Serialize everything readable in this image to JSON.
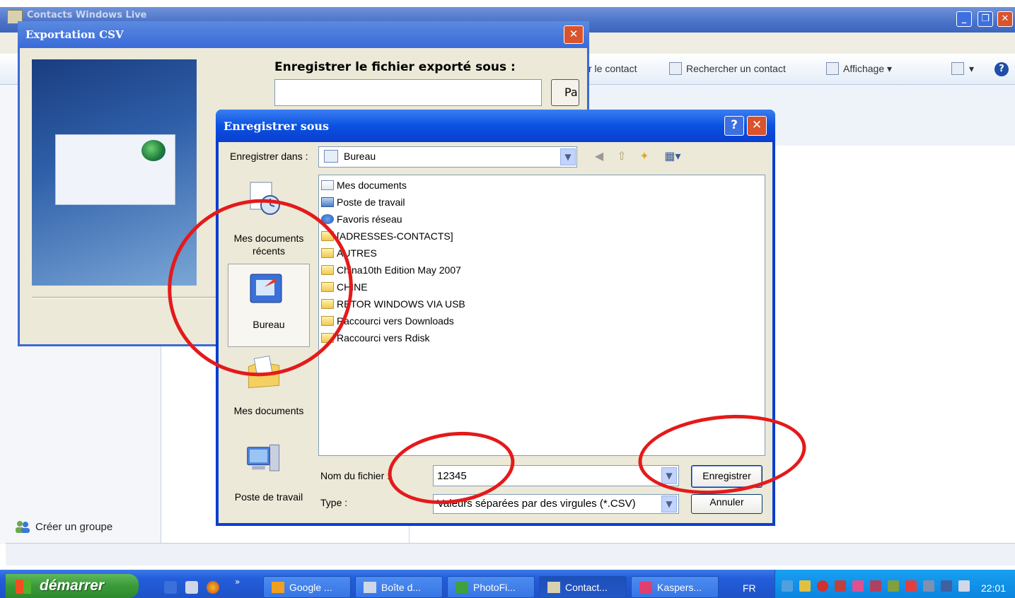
{
  "app": {
    "title": "Contacts Windows Live",
    "toolbar": {
      "item_contact": "r le contact",
      "search_contact": "Rechercher un contact",
      "view": "Affichage ▾",
      "more": "▾"
    },
    "left_pane": {
      "create_group": "Créer un groupe"
    }
  },
  "csv_dialog": {
    "title": "Exportation CSV",
    "save_as_label": "Enregistrer le fichier exporté sous :",
    "path_value": "",
    "browse_label": "Pa"
  },
  "save_dialog": {
    "title": "Enregistrer sous",
    "save_in_label": "Enregistrer dans :",
    "save_in_value": "Bureau",
    "places": [
      {
        "label": "Mes documents récents"
      },
      {
        "label": "Bureau"
      },
      {
        "label": "Mes documents"
      },
      {
        "label": "Poste de travail"
      }
    ],
    "files": [
      {
        "name": "Mes documents",
        "icon": "docs"
      },
      {
        "name": "Poste de travail",
        "icon": "pc"
      },
      {
        "name": "Favoris réseau",
        "icon": "net"
      },
      {
        "name": "[ADRESSES-CONTACTS]",
        "icon": "folder"
      },
      {
        "name": "AUTRES",
        "icon": "folder"
      },
      {
        "name": "China10th Edition May 2007",
        "icon": "folder"
      },
      {
        "name": "CHINE",
        "icon": "folder"
      },
      {
        "name": "RETOR WINDOWS VIA USB",
        "icon": "folder"
      },
      {
        "name": "Raccourci vers Downloads",
        "icon": "shortcut"
      },
      {
        "name": "Raccourci vers Rdisk",
        "icon": "shortcut"
      }
    ],
    "filename_label": "Nom du fichier :",
    "filename_value": "12345",
    "type_label": "Type :",
    "type_value": "Valeurs séparées par des virgules (*.CSV)",
    "save_button": "Enregistrer",
    "cancel_button": "Annuler"
  },
  "taskbar": {
    "start_label": "démarrer",
    "tasks": [
      {
        "label": "Google ...",
        "active": false
      },
      {
        "label": "Boîte d...",
        "active": false
      },
      {
        "label": "PhotoFi...",
        "active": false
      },
      {
        "label": "Contact...",
        "active": true
      },
      {
        "label": "Kaspers...",
        "active": false
      }
    ],
    "language": "FR",
    "clock": "22:01"
  },
  "colors": {
    "xp_blue": "#0a3ecf",
    "annotation_red": "#e41a1a",
    "start_green": "#3a9a38"
  }
}
